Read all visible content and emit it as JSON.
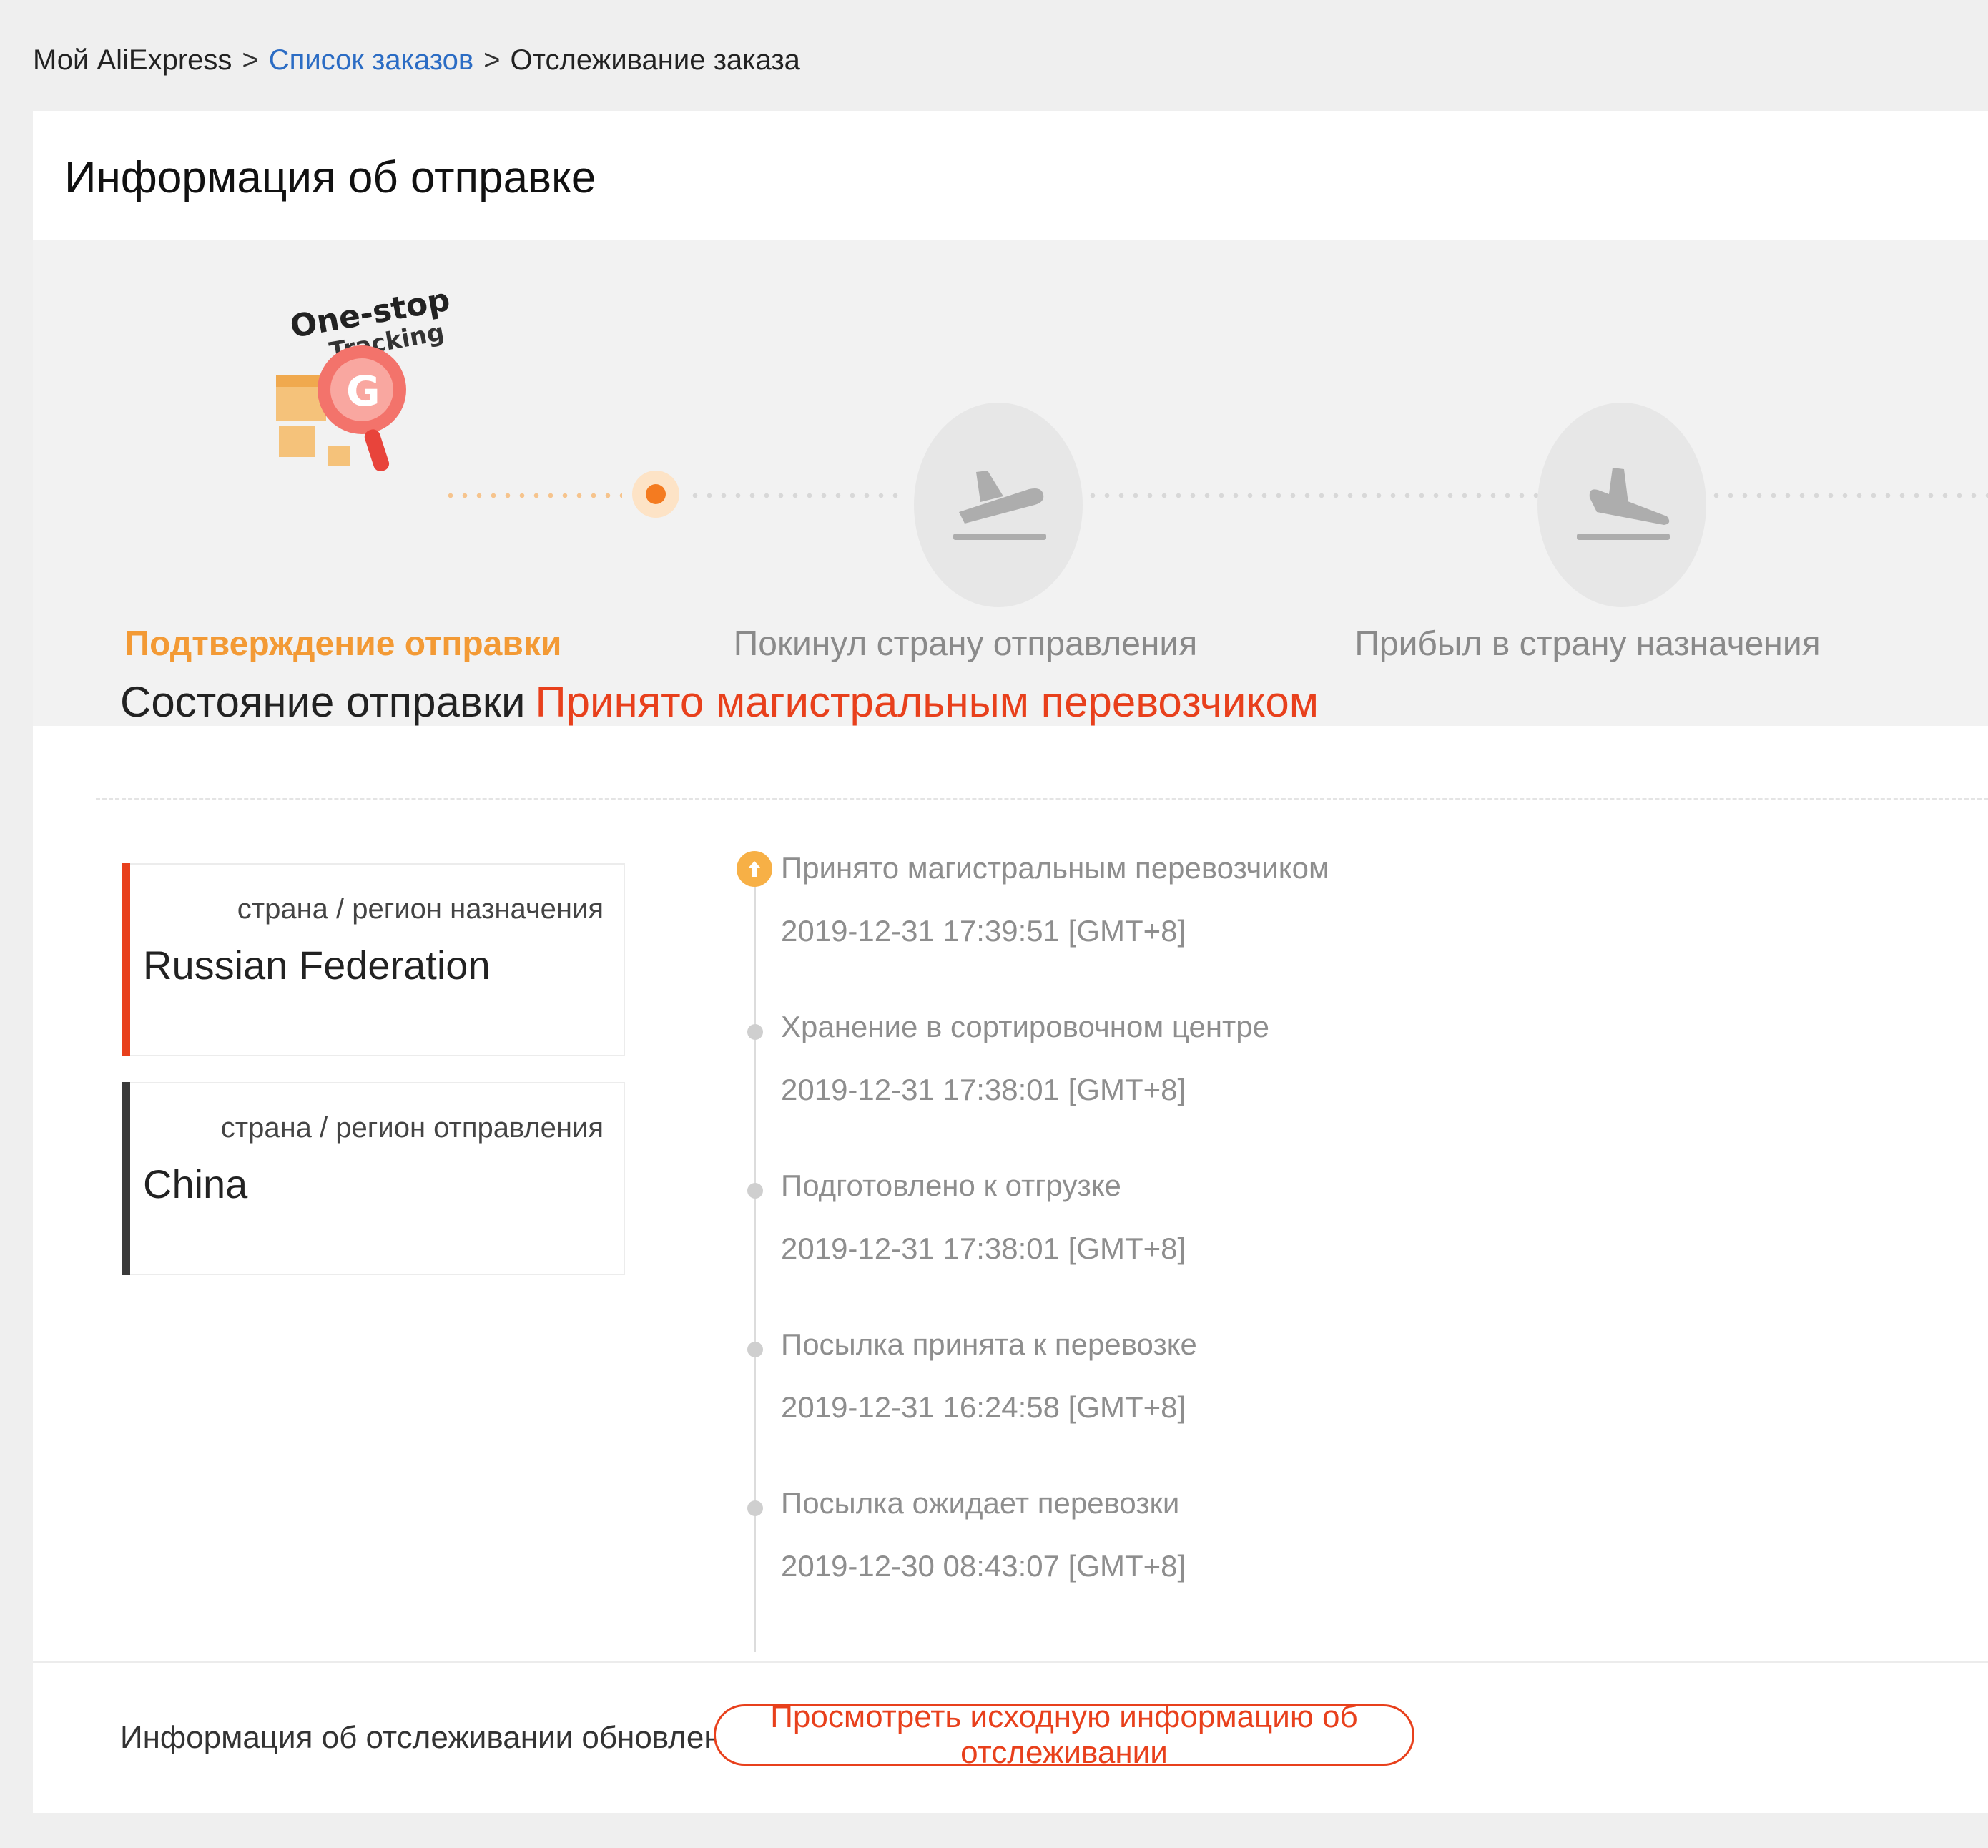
{
  "breadcrumb": {
    "home": "Мой AliExpress",
    "sep1": ">",
    "orders": "Список заказов",
    "sep2": ">",
    "current": "Отслеживание заказа"
  },
  "panel": {
    "title": "Информация об отправке"
  },
  "logo": {
    "line1": "One-stop",
    "line2": "Tracking"
  },
  "steps": [
    {
      "label": "Подтверждение отправки",
      "state": "active"
    },
    {
      "label": "Покинул страну отправления",
      "state": "inactive",
      "icon": "plane-departure-icon"
    },
    {
      "label": "Прибыл в страну назначения",
      "state": "inactive",
      "icon": "plane-arrival-icon"
    }
  ],
  "status": {
    "label": "Состояние отправки",
    "value": "Принято магистральным перевозчиком"
  },
  "destination": {
    "caption": "страна / регион назначения",
    "country": "Russian Federation"
  },
  "origin": {
    "caption": "страна / регион отправления",
    "country": "China"
  },
  "events": [
    {
      "title": "Принято магистральным перевозчиком",
      "time": "2019-12-31 17:39:51 [GMT+8]"
    },
    {
      "title": "Хранение в сортировочном центре",
      "time": "2019-12-31 17:38:01 [GMT+8]"
    },
    {
      "title": "Подготовлено к отгрузке",
      "time": "2019-12-31 17:38:01 [GMT+8]"
    },
    {
      "title": "Посылка принята к перевозке",
      "time": "2019-12-31 16:24:58 [GMT+8]"
    },
    {
      "title": "Посылка ожидает перевозки",
      "time": "2019-12-30 08:43:07 [GMT+8]"
    }
  ],
  "footer": {
    "note": "Информация об отслеживании обновлена выше",
    "button": "Просмотреть исходную информацию об отслеживании"
  },
  "colors": {
    "accent_orange": "#f47b20",
    "status_red": "#e8401c",
    "link_blue": "#2b6cc4"
  }
}
